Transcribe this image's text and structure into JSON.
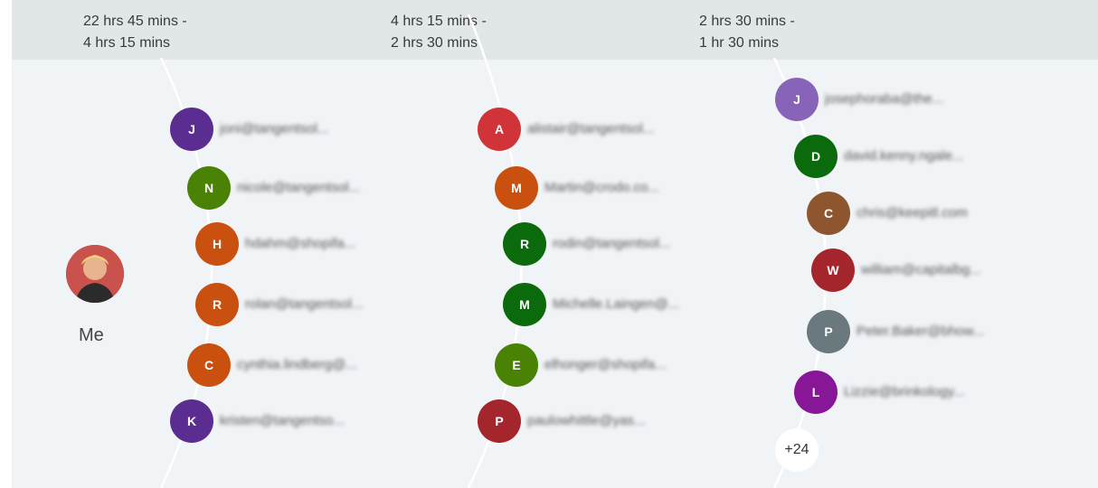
{
  "columns": [
    {
      "line1": "22 hrs 45 mins -",
      "line2": "4 hrs 15 mins"
    },
    {
      "line1": "4 hrs 15 mins -",
      "line2": "2 hrs 30 mins"
    },
    {
      "line1": "2 hrs 30 mins -",
      "line2": "1 hr 30 mins"
    }
  ],
  "me": {
    "label": "Me"
  },
  "group1": [
    {
      "initial": "J",
      "color": "#5c2d91",
      "email": "joni@tangentsol..."
    },
    {
      "initial": "N",
      "color": "#498205",
      "email": "nicole@tangentsol..."
    },
    {
      "initial": "H",
      "color": "#ca5010",
      "email": "hdahm@shopifa..."
    },
    {
      "initial": "R",
      "color": "#ca5010",
      "email": "rolan@tangentsol..."
    },
    {
      "initial": "C",
      "color": "#ca5010",
      "email": "cynthia.lindberg@..."
    },
    {
      "initial": "K",
      "color": "#5c2d91",
      "email": "kristen@tangentso..."
    }
  ],
  "group2": [
    {
      "initial": "A",
      "color": "#d13438",
      "email": "alistair@tangentsol..."
    },
    {
      "initial": "M",
      "color": "#ca5010",
      "email": "Martin@crodo.co..."
    },
    {
      "initial": "R",
      "color": "#0b6a0b",
      "email": "rodin@tangentsol..."
    },
    {
      "initial": "M",
      "color": "#0b6a0b",
      "email": "Michelle.Laingen@..."
    },
    {
      "initial": "E",
      "color": "#498205",
      "email": "elhonger@shopifa..."
    },
    {
      "initial": "P",
      "color": "#a4262c",
      "email": "paulowhittle@yas..."
    }
  ],
  "group3": [
    {
      "initial": "J",
      "color": "#8764b8",
      "email": "josephoraba@the..."
    },
    {
      "initial": "D",
      "color": "#0b6a0b",
      "email": "david.kenny.ngale..."
    },
    {
      "initial": "C",
      "color": "#8e562e",
      "email": "chris@keepitl.com"
    },
    {
      "initial": "W",
      "color": "#a4262c",
      "email": "william@capitalbg..."
    },
    {
      "initial": "P",
      "color": "#69797e",
      "email": "Peter.Baker@bhow..."
    },
    {
      "initial": "L",
      "color": "#881798",
      "email": "Lizzie@brinkology..."
    }
  ],
  "more": {
    "label": "+24"
  }
}
